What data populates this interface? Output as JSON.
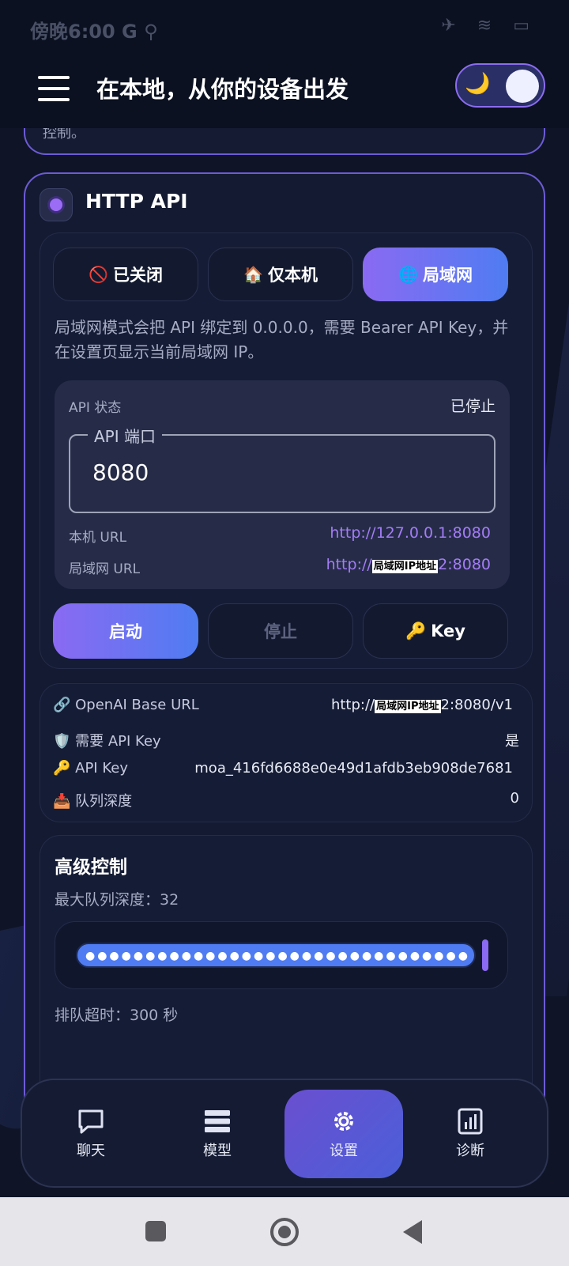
{
  "status_bar": {
    "left_text": "傍晚6:00 G ⚲",
    "right_icons": "✈ ≋ ▭"
  },
  "header": {
    "title": "在本地，从你的设备出发",
    "theme_icon": "moon-icon"
  },
  "prev_card_tail": "控制。",
  "http_api": {
    "title": "HTTP API",
    "modes": [
      {
        "icon": "🚫",
        "label": "已关闭",
        "active": false
      },
      {
        "icon": "🏠",
        "label": "仅本机",
        "active": false
      },
      {
        "icon": "🌐",
        "label": "局域网",
        "active": true
      }
    ],
    "description": "局域网模式会把 API 绑定到 0.0.0.0，需要 Bearer API Key，并在设置页显示当前局域网 IP。",
    "status_label": "API 状态",
    "status_value": "已停止",
    "port_legend": "API 端口",
    "port_value": "8080",
    "local_url_label": "本机 URL",
    "local_url_value": "http://127.0.0.1:8080",
    "lan_url_label": "局域网 URL",
    "lan_url_prefix": "http://",
    "lan_url_redacted": "局域网IP地址",
    "lan_url_suffix": "2:8080",
    "buttons": {
      "start": "启动",
      "stop": "停止",
      "key": "Key",
      "key_icon": "🔑"
    }
  },
  "info": {
    "base_url_label": "🔗 OpenAI Base URL",
    "base_url_prefix": "http://",
    "base_url_redacted": "局域网IP地址",
    "base_url_suffix": "2:8080/v1",
    "need_key_label": "🛡️ 需要 API Key",
    "need_key_value": "是",
    "api_key_label": "🔑 API Key",
    "api_key_value": "moa_416fd6688e0e49d1afdb3eb908de7681",
    "queue_label": "📥 队列深度",
    "queue_value": "0"
  },
  "advanced": {
    "title": "高级控制",
    "max_queue_label": "最大队列深度：32",
    "max_queue_value": 32,
    "timeout_label": "排队超时：300 秒"
  },
  "bottom_nav": [
    {
      "label": "聊天",
      "icon": "chat-icon",
      "active": false
    },
    {
      "label": "模型",
      "icon": "stack-icon",
      "active": false
    },
    {
      "label": "设置",
      "icon": "gear-icon",
      "active": true
    },
    {
      "label": "诊断",
      "icon": "chart-icon",
      "active": false
    }
  ],
  "colors": {
    "accent": "#8a6af2",
    "accent2": "#4f7cf2",
    "link": "#a47cf7",
    "bg": "#0f1527"
  }
}
